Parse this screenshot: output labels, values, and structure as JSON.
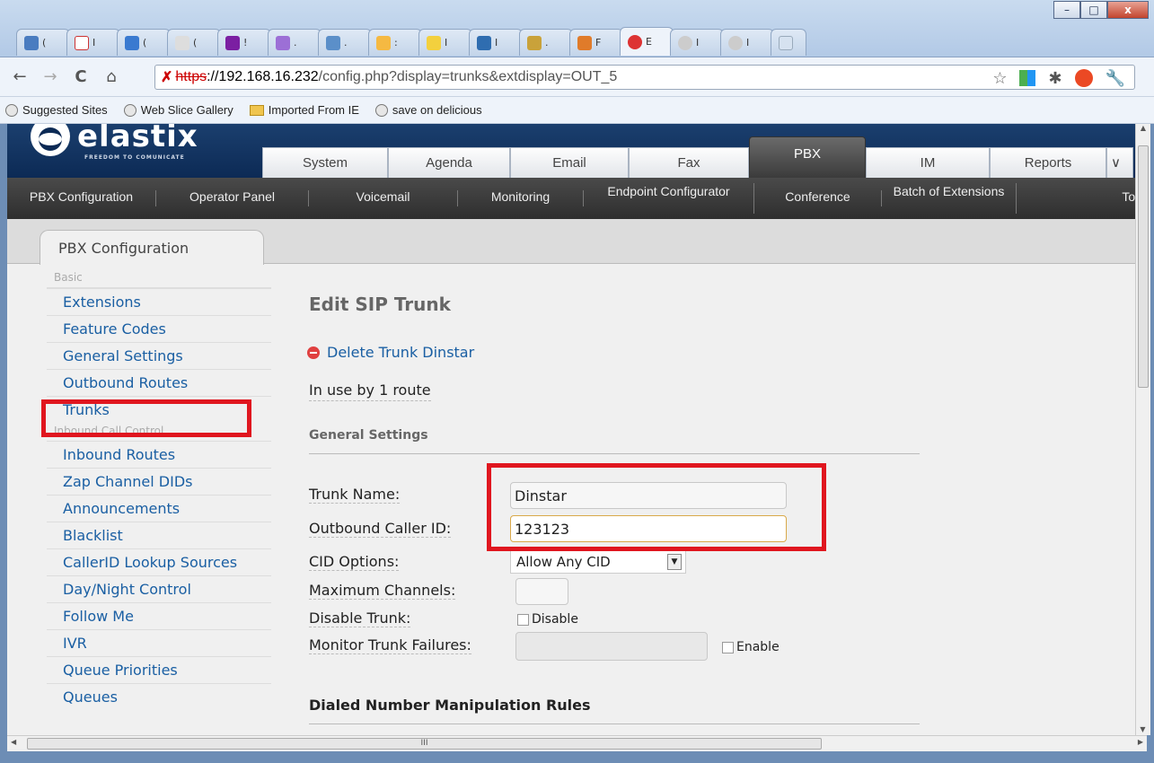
{
  "browser": {
    "tabs": [
      "(",
      "I",
      "(",
      "(",
      "!",
      ".",
      ".",
      ":",
      "I",
      "I",
      ".",
      "F",
      "E",
      "I",
      "I"
    ],
    "url_scheme": "https",
    "url_host": "://192.168.16.232",
    "url_path": "/config.php?display=trunks&extdisplay=OUT_5",
    "bookmarks": [
      "Suggested Sites",
      "Web Slice Gallery",
      "Imported From IE",
      "save on delicious"
    ],
    "window_controls": {
      "minimize": "–",
      "maximize": "□",
      "close": "x"
    },
    "nav": {
      "back": "←",
      "forward": "→",
      "reload": "C",
      "home": "⌂"
    },
    "hscroll_label": "III"
  },
  "header": {
    "logo_text": "elastix",
    "logo_tagline": "FREEDOM TO COMUNICATE",
    "main_tabs": [
      "System",
      "Agenda",
      "Email",
      "Fax",
      "PBX",
      "IM",
      "Reports"
    ],
    "sub_nav": [
      "PBX Configuration",
      "Operator Panel",
      "Voicemail",
      "Monitoring",
      "Endpoint Configurator",
      "Conference",
      "Batch of Extensions",
      "Tool"
    ]
  },
  "sidebar": {
    "tab_label": "PBX Configuration",
    "group_basic": "Basic",
    "basic_items": [
      "Extensions",
      "Feature Codes",
      "General Settings",
      "Outbound Routes",
      "Trunks"
    ],
    "group_inbound": "Inbound Call Control",
    "inbound_items": [
      "Inbound Routes",
      "Zap Channel DIDs",
      "Announcements",
      "Blacklist",
      "CallerID Lookup Sources",
      "Day/Night Control",
      "Follow Me",
      "IVR",
      "Queue Priorities",
      "Queues"
    ]
  },
  "main": {
    "title": "Edit SIP Trunk",
    "delete_link": "Delete Trunk Dinstar",
    "in_use": "In use by 1 route",
    "general_settings": "General Settings",
    "trunk_name_label": "Trunk Name:",
    "trunk_name_value": "Dinstar",
    "outbound_cid_label": "Outbound Caller ID:",
    "outbound_cid_value": "123123",
    "cid_options_label": "CID Options:",
    "cid_options_value": "Allow Any CID",
    "max_channels_label": "Maximum Channels:",
    "disable_trunk_label": "Disable Trunk:",
    "disable_checkbox": "Disable",
    "monitor_label": "Monitor Trunk Failures:",
    "enable_checkbox": "Enable",
    "dialed_rules": "Dialed Number Manipulation Rules"
  },
  "colors": {
    "highlight": "#e0161f",
    "link": "#1a5fa3",
    "header_bg": "#0c2a55"
  }
}
